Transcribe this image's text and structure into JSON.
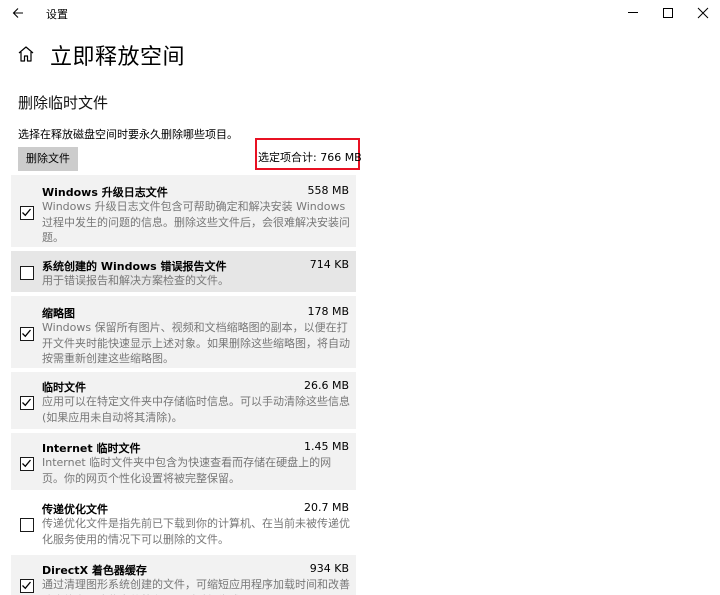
{
  "titlebar": {
    "title": "设置",
    "back_icon": "back-arrow-icon",
    "minimize_icon": "minimize-icon",
    "maximize_icon": "maximize-icon",
    "close_icon": "close-icon"
  },
  "header": {
    "home_icon": "home-icon",
    "page_title": "立即释放空间"
  },
  "section": {
    "title": "删除临时文件",
    "description": "选择在释放磁盘空间时要永久删除哪些项目。",
    "delete_button": "删除文件",
    "total_label": "选定项合计: 766 MB",
    "highlight_color": "#e81123"
  },
  "items": [
    {
      "name": "Windows 升级日志文件",
      "size": "558 MB",
      "checked": true,
      "description": "Windows 升级日志文件包含可帮助确定和解决安装 Windows 过程中发生的问题的信息。删除这些文件后，会很难解决安装问题。"
    },
    {
      "name": "系统创建的 Windows 错误报告文件",
      "size": "714 KB",
      "checked": false,
      "description": "用于错误报告和解决方案检查的文件。"
    },
    {
      "name": "缩略图",
      "size": "178 MB",
      "checked": true,
      "description": "Windows 保留所有图片、视频和文档缩略图的副本，以便在打开文件夹时能快速显示上述对象。如果删除这些缩略图，将自动按需重新创建这些缩略图。"
    },
    {
      "name": "临时文件",
      "size": "26.6 MB",
      "checked": true,
      "description": "应用可以在特定文件夹中存储临时信息。可以手动清除这些信息(如果应用未自动将其清除)。"
    },
    {
      "name": "Internet 临时文件",
      "size": "1.45 MB",
      "checked": true,
      "description": "Internet 临时文件夹中包含为快速查看而存储在硬盘上的网页。你的网页个性化设置将被完整保留。"
    },
    {
      "name": "传递优化文件",
      "size": "20.7 MB",
      "checked": false,
      "description": "传递优化文件是指先前已下载到你的计算机、在当前未被传递优化服务使用的情况下可以删除的文件。"
    },
    {
      "name": "DirectX 着色器缓存",
      "size": "934 KB",
      "checked": true,
      "description": "通过清理图形系统创建的文件，可缩短应用程序加载时间和改善响应能力。这些文件将在需要时重新生成。"
    }
  ],
  "colors": {
    "window_bg": "#ffffff",
    "item_shade": "#f2f2f2",
    "item_hover": "#e6e6e6",
    "button_bg": "#cccccc",
    "desc_text": "#777777"
  }
}
